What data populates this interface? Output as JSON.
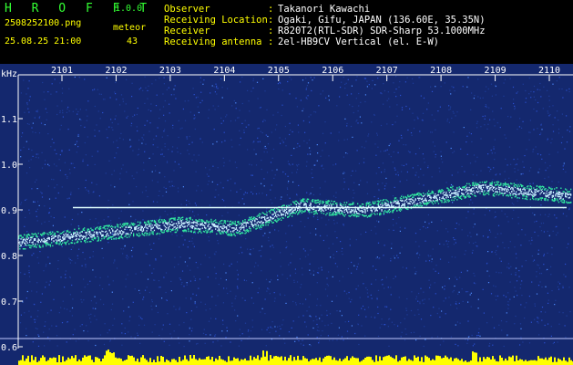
{
  "header": {
    "app_name": "H R O F F T",
    "version": "1.0.0",
    "filename": "2508252100.png",
    "datetime": "25.08.25 21:00",
    "meteor_label": "meteor",
    "meteor_count": "43",
    "info": [
      {
        "label": "Observer",
        "colon": ":",
        "value": "Takanori Kawachi"
      },
      {
        "label": "Receiving Location",
        "colon": ":",
        "value": "Ogaki, Gifu, JAPAN (136.60E, 35.35N)"
      },
      {
        "label": "Receiver",
        "colon": ":",
        "value": "R820T2(RTL-SDR) SDR-Sharp 53.1000MHz"
      },
      {
        "label": "Receiving antenna",
        "colon": ":",
        "value": "2el-HB9CV Vertical (el. E-W)"
      }
    ]
  },
  "spectrogram": {
    "y_unit": "kHz",
    "y_ticks": [
      "1.1",
      "1.0",
      "0.9",
      "0.8",
      "0.7",
      "0.6"
    ],
    "y_tick_values": [
      1.1,
      1.0,
      0.9,
      0.8,
      0.7,
      0.6
    ],
    "x_ticks": [
      "2101",
      "2102",
      "2103",
      "2104",
      "2105",
      "2106",
      "2107",
      "2108",
      "2109",
      "2110"
    ],
    "x_tick_values": [
      2101,
      2102,
      2103,
      2104,
      2105,
      2106,
      2107,
      2108,
      2109,
      2110
    ],
    "carrier_khz": 0.905,
    "colors": {
      "background": "#14286e",
      "noise": "#2a50d0",
      "echo": "#c8f0ff",
      "carrier": "#e0ffff",
      "axis": "#ffffff",
      "activity": "#ffff00"
    }
  }
}
